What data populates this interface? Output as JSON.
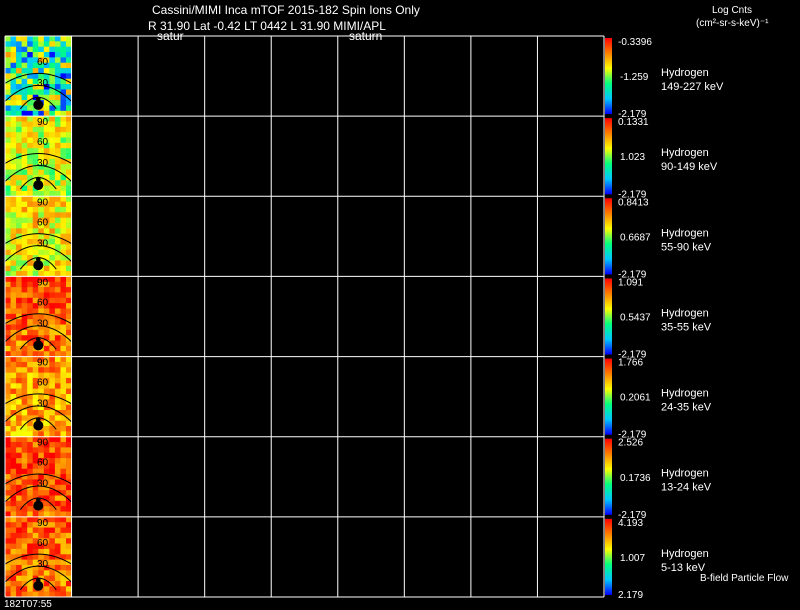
{
  "header": {
    "title": "Cassini/MIMI Inca mTOF  2015-182   Spin   Ions Only",
    "line2": "R        31.90 Lat -0.42 LT 0442 L          31.90  MIMI/APL",
    "label_left": "satur",
    "label_mid": "saturn",
    "units_title": "Log Cnts",
    "units": "(cm²-sr-s-keV)⁻¹"
  },
  "footer": {
    "timestamp": "182T07:55",
    "note": "B-field Particle Flow"
  },
  "colors": {
    "background": "#000000",
    "grid": "#ffffff",
    "text": "#ffffff"
  },
  "chart_data": {
    "type": "heatmap",
    "title": "Cassini/MIMI Inca mTOF  2015-182   Spin   Ions Only",
    "species": "Hydrogen",
    "grid": true,
    "image_grid": {
      "rows": 7,
      "cols": 9
    },
    "angle_labels": [
      "90",
      "60",
      "30"
    ],
    "colorbar_palette": [
      "#0000ff",
      "#00c8ff",
      "#00ff80",
      "#ffff00",
      "#ff8000",
      "#ff0000"
    ],
    "panels": [
      {
        "label": "Hydrogen",
        "energy": "149-227 keV",
        "cb_max": "-0.3396",
        "cb_mid": "-1.259",
        "cb_min": "-2.179",
        "angle_labels": [
          "",
          "60",
          "30"
        ],
        "fill_level": 0.4
      },
      {
        "label": "Hydrogen",
        "energy": "90-149 keV",
        "cb_max": "0.1331",
        "cb_mid": "1.023",
        "cb_min": "-2.179",
        "angle_labels": [
          "90",
          "60",
          "30"
        ],
        "fill_level": 0.6
      },
      {
        "label": "Hydrogen",
        "energy": "55-90 keV",
        "cb_max": "0.8413",
        "cb_mid": "0.6687",
        "cb_min": "-2.179",
        "angle_labels": [
          "90",
          "60",
          "30"
        ],
        "fill_level": 0.66
      },
      {
        "label": "Hydrogen",
        "energy": "35-55 keV",
        "cb_max": "1.091",
        "cb_mid": "0.5437",
        "cb_min": "-2.179",
        "angle_labels": [
          "90",
          "60",
          "30"
        ],
        "fill_level": 0.86
      },
      {
        "label": "Hydrogen",
        "energy": "24-35 keV",
        "cb_max": "1.766",
        "cb_mid": "0.2061",
        "cb_min": "-2.179",
        "angle_labels": [
          "90",
          "60",
          "30"
        ],
        "fill_level": 0.78
      },
      {
        "label": "Hydrogen",
        "energy": "13-24 keV",
        "cb_max": "2.526",
        "cb_mid": "0.1736",
        "cb_min": "-2.179",
        "angle_labels": [
          "90",
          "60",
          "30"
        ],
        "fill_level": 0.9
      },
      {
        "label": "Hydrogen",
        "energy": "5-13 keV",
        "cb_max": "4.193",
        "cb_mid": "1.007",
        "cb_min": "2.179",
        "angle_labels": [
          "90",
          "60",
          "30"
        ],
        "fill_level": 0.86
      }
    ]
  }
}
